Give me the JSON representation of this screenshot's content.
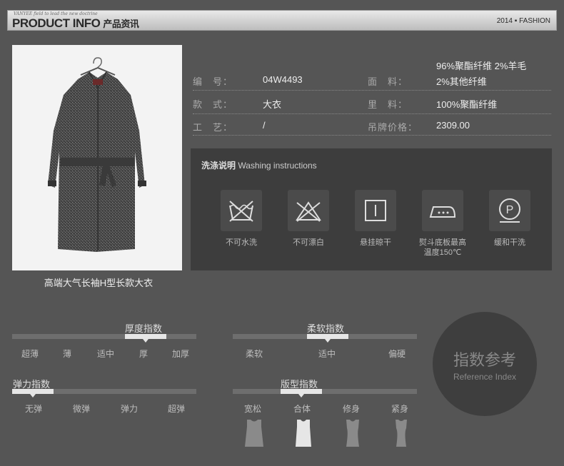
{
  "header": {
    "tagline": "VANYEE field to lead the new doctrine",
    "title": "PRODUCT INFO",
    "title_cn": "产品资讯",
    "year": "2014",
    "bullet": "▪",
    "fashion": "FASHION"
  },
  "product": {
    "caption": "高端大气长袖H型长款大衣",
    "rows": [
      {
        "label": "编　号：",
        "value": "04W4493",
        "label2": "面　料：",
        "value2": "96%聚酯纤维 2%羊毛",
        "value2b": "2%其他纤维"
      },
      {
        "label": "款　式：",
        "value": "大衣",
        "label2": "里　料：",
        "value2": "100%聚酯纤维"
      },
      {
        "label": "工　艺：",
        "value": "/",
        "label2": "吊牌价格：",
        "value2": "2309.00"
      }
    ]
  },
  "washing": {
    "title_cn": "洗涤说明",
    "title_en": "Washing instructions",
    "items": [
      {
        "icon": "no-wash-icon",
        "label": "不可水洗"
      },
      {
        "icon": "no-bleach-icon",
        "label": "不可漂白"
      },
      {
        "icon": "hang-dry-icon",
        "label": "悬挂晾干"
      },
      {
        "icon": "iron-icon",
        "label": "熨斗底板最高",
        "label2": "温度150℃"
      },
      {
        "icon": "dry-clean-icon",
        "label": "缓和干洗"
      }
    ]
  },
  "indices": {
    "thickness": {
      "title": "厚度指数",
      "options": [
        "超薄",
        "薄",
        "适中",
        "厚",
        "加厚"
      ],
      "selected": "厚"
    },
    "softness": {
      "title": "柔软指数",
      "options": [
        "柔软",
        "适中",
        "偏硬"
      ],
      "selected": "适中"
    },
    "elasticity": {
      "title": "弹力指数",
      "options": [
        "无弹",
        "微弹",
        "弹力",
        "超弹"
      ],
      "selected": "无弹"
    },
    "fit": {
      "title": "版型指数",
      "options": [
        "宽松",
        "合体",
        "修身",
        "紧身"
      ],
      "selected": "合体"
    }
  },
  "reference": {
    "title": "指数参考",
    "subtitle": "Reference Index"
  },
  "colors": {
    "selected": "#e6e6e6",
    "unselected": "#6e6e6e",
    "panel": "#3d3d3d"
  }
}
